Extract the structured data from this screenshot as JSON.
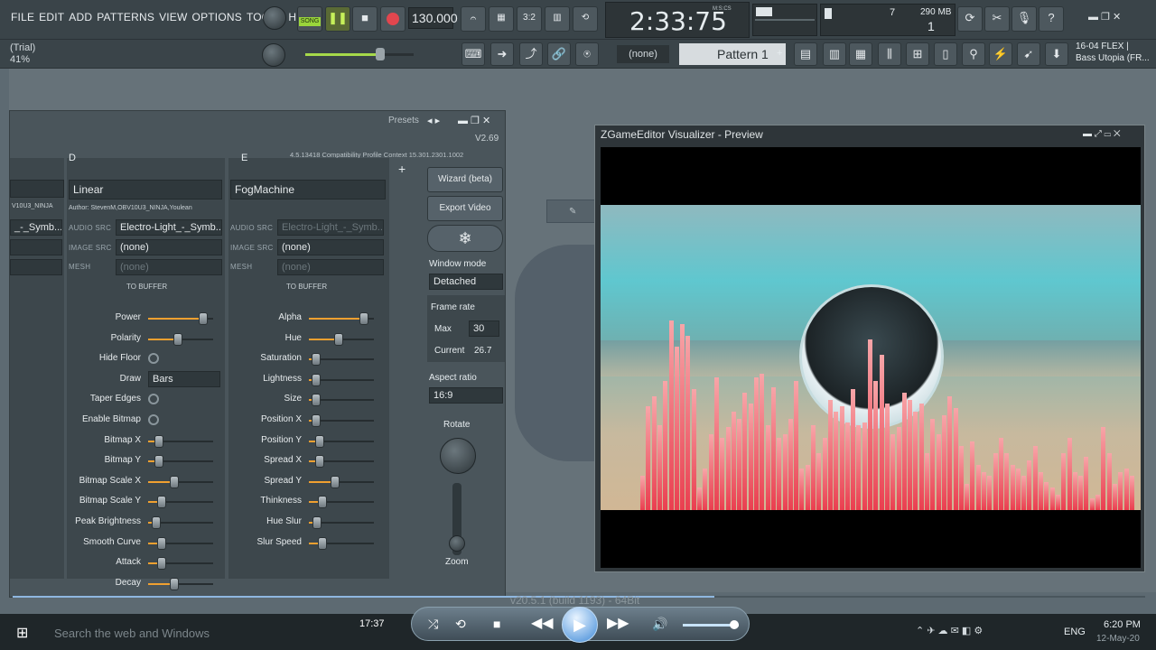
{
  "menu": [
    "FILE",
    "EDIT",
    "ADD",
    "PATTERNS",
    "VIEW",
    "OPTIONS",
    "TOOLS",
    "HELP"
  ],
  "transport": {
    "song_label": "SONG",
    "tempo": "130.000",
    "time": "2:33:75",
    "time_unit": "M:S:CS",
    "mem_val": "7",
    "mem": "290 MB",
    "cpu_val": "1"
  },
  "hint": {
    "title": "(Trial)",
    "value": "41%"
  },
  "pattern": {
    "channel": "(none)",
    "name": "Pattern 1"
  },
  "browser": {
    "line1": "16-04  FLEX |",
    "line2": "Bass Utopia (FR..."
  },
  "plugin": {
    "presets_label": "Presets",
    "version": "V2.69",
    "context": "4.5.13418 Compatibility Profile Context 15.301.2301.1002",
    "col_a": {
      "author": "V10U3_NINJA",
      "audio": "_-_Symb..."
    },
    "col_d": {
      "letter": "D",
      "effect": "Linear",
      "author": "Author: StevenM,OBV10U3_NINJA,Youlean",
      "audio_lbl": "AUDIO SRC",
      "audio": "Electro-Light_-_Symb...",
      "image_lbl": "IMAGE SRC",
      "image": "(none)",
      "mesh_lbl": "MESH",
      "mesh": "(none)",
      "buffer": "TO BUFFER"
    },
    "col_e": {
      "letter": "E",
      "effect": "FogMachine",
      "audio_lbl": "AUDIO SRC",
      "audio": "Electro-Light_-_Symb...",
      "image_lbl": "IMAGE SRC",
      "image": "(none)",
      "mesh_lbl": "MESH",
      "mesh": "(none)",
      "buffer": "TO BUFFER"
    },
    "params_d": [
      "Power",
      "Polarity",
      "Hide Floor",
      "Draw",
      "Taper Edges",
      "Enable Bitmap",
      "Bitmap X",
      "Bitmap Y",
      "Bitmap Scale X",
      "Bitmap Scale Y",
      "Peak Brightness",
      "Smooth Curve",
      "Attack",
      "Decay"
    ],
    "draw_value": "Bars",
    "params_e": [
      "Alpha",
      "Hue",
      "Saturation",
      "Lightness",
      "Size",
      "Position X",
      "Position Y",
      "Spread X",
      "Spread Y",
      "Thinkness",
      "Hue Slur",
      "Slur Speed"
    ],
    "side": {
      "wizard": "Wizard (beta)",
      "export": "Export Video",
      "window_mode": "Window mode",
      "window_value": "Detached",
      "frame_rate": "Frame rate",
      "max_lbl": "Max",
      "max_val": "30",
      "current_lbl": "Current",
      "current_val": "26.7",
      "aspect": "Aspect ratio",
      "aspect_val": "16:9",
      "rotate": "Rotate",
      "zoom": "Zoom"
    }
  },
  "viz": {
    "title": "ZGameEditor Visualizer - Preview",
    "bars": [
      18,
      55,
      60,
      45,
      68,
      100,
      86,
      98,
      92,
      64,
      12,
      22,
      40,
      70,
      38,
      44,
      52,
      48,
      62,
      56,
      70,
      72,
      45,
      65,
      38,
      40,
      48,
      68,
      22,
      24,
      45,
      30,
      38,
      58,
      52,
      55,
      46,
      64,
      45,
      46,
      90,
      68,
      82,
      56,
      40,
      44,
      62,
      58,
      52,
      56,
      30,
      48,
      40,
      50,
      60,
      54,
      34,
      14,
      36,
      24,
      20,
      18,
      30,
      38,
      30,
      24,
      22,
      18,
      26,
      34,
      20,
      15,
      12,
      8,
      30,
      38,
      20,
      18,
      28,
      6,
      8,
      44,
      30,
      14,
      20,
      22,
      18
    ]
  },
  "player": {
    "time": "17:37"
  },
  "taskbar": {
    "search": "Search the web and Windows",
    "lang": "ENG",
    "clock": "6:20 PM",
    "date": "12-May-20",
    "status_text": "v20.5.1 (build 1193) - 64Bit"
  }
}
